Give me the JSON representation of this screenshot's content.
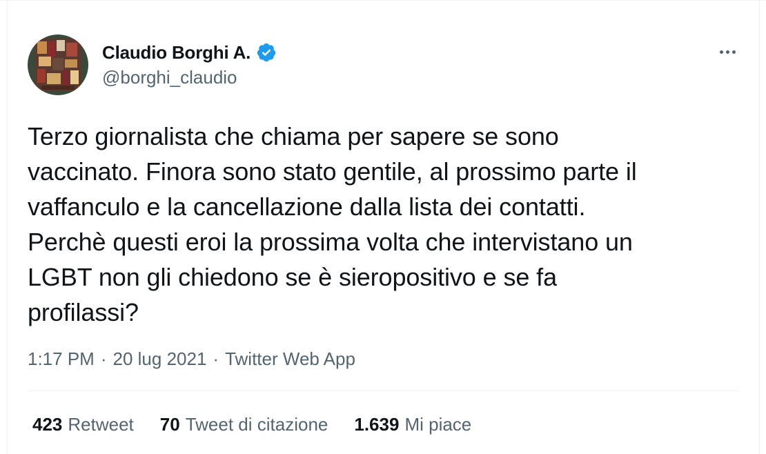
{
  "author": {
    "display_name": "Claudio Borghi A.",
    "handle": "@borghi_claudio",
    "verified": true,
    "verified_icon": "verified-badge-icon"
  },
  "tweet": {
    "text": "Terzo giornalista che chiama per sapere se sono\nvaccinato. Finora sono stato gentile, al prossimo parte il\nvaffanculo e la cancellazione dalla lista dei contatti.\nPerchè questi eroi la prossima volta che intervistano un\nLGBT non gli chiedono se è sieropositivo e se fa\nprofilassi?",
    "time": "1:17 PM",
    "date": "20 lug 2021",
    "separator": "·",
    "source": "Twitter Web App"
  },
  "stats": {
    "retweets_count": "423",
    "retweets_label": "Retweet",
    "quotes_count": "70",
    "quotes_label": "Tweet di citazione",
    "likes_count": "1.639",
    "likes_label": "Mi piace"
  },
  "colors": {
    "text": "#0f1419",
    "secondary": "#536471",
    "verified": "#1d9bf0",
    "divider": "#eff3f4"
  },
  "icons": {
    "more": "more-options-icon"
  }
}
